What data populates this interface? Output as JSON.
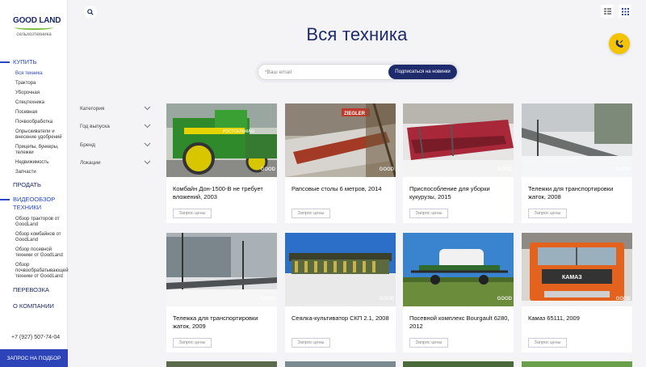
{
  "brand": {
    "name": "GOOD LAND",
    "tagline": "сельхозтехника"
  },
  "nav": {
    "buy": "КУПИТЬ",
    "buy_items": [
      "Вся техника",
      "Трактора",
      "Уборочная",
      "Спецтехника",
      "Посевная",
      "Почвообработка",
      "Опрыскиватели и внесение удобрений",
      "Прицепы, бункеры, тележки",
      "Недвижимость",
      "Запчасти"
    ],
    "sell": "ПРОДАТЬ",
    "video": "ВИДЕООБЗОР ТЕХНИКИ",
    "video_items": [
      "Обзор тракторов от GoodLand",
      "Обзор комбайнов от GoodLand",
      "Обзор посевной техники от GoodLand",
      "Обзор почвообрабатывающей техники от GoodLand"
    ],
    "transport": "ПЕРЕВОЗКА",
    "about": "О КОМПАНИИ"
  },
  "phone": "+7 (927) 507-74-04",
  "cta": "ЗАПРОС НА ПОДБОР",
  "page_title": "Вся техника",
  "subscribe": {
    "placeholder": "*Ваш email",
    "button": "Подписаться на новинки"
  },
  "filters": [
    "Категория",
    "Год выпуска",
    "Бренд",
    "Локации"
  ],
  "request_label": "Запрос цены",
  "watermark": "GOOD",
  "cards": [
    {
      "title": "Комбайн Дон-1500-В не требует вложений, 2003",
      "photo_text": "РОСТСЕЛЬМАШ"
    },
    {
      "title": "Рапсовые столы 6 метров, 2014",
      "photo_text": "ZIEGLER"
    },
    {
      "title": "Приспособление для уборки кукурузы, 2015",
      "photo_text": ""
    },
    {
      "title": "Тележки для транспортировки жаток, 2008",
      "photo_text": ""
    },
    {
      "title": "Тележка для транспортировки жаток, 2009",
      "photo_text": ""
    },
    {
      "title": "Сеялка-культиватор СКП 2.1, 2008",
      "photo_text": ""
    },
    {
      "title": "Посевной комплекс Bourgault 6280, 2012",
      "photo_text": ""
    },
    {
      "title": "Камаз 65111, 2009",
      "photo_text": "КАМАЗ"
    }
  ],
  "colors": {
    "brand_navy": "#1d2a6b",
    "accent_blue": "#2d43b8",
    "call_yellow": "#f5c400",
    "logo_green": "#7bbd3f"
  },
  "icons": {
    "search": "search-icon",
    "list_view": "list-view-icon",
    "grid_view": "grid-view-icon",
    "call": "phone-call-icon"
  }
}
